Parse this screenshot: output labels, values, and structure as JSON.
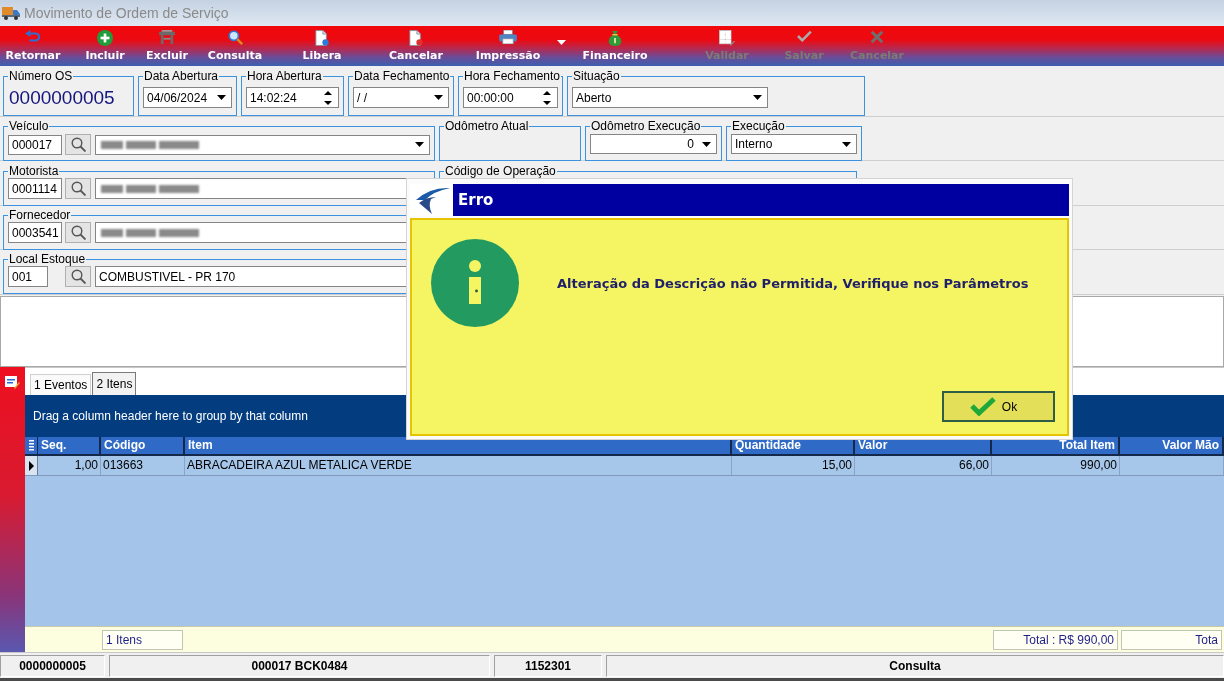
{
  "window": {
    "title": "Movimento de Ordem de Serviço"
  },
  "toolbar": [
    {
      "label": "Retornar",
      "disabled": false,
      "dropdown": false
    },
    {
      "label": "Incluir",
      "disabled": false,
      "dropdown": false
    },
    {
      "label": "Excluir",
      "disabled": false,
      "dropdown": false
    },
    {
      "label": "Consulta",
      "disabled": false,
      "dropdown": false
    },
    {
      "label": "Libera",
      "disabled": false,
      "dropdown": false
    },
    {
      "label": "Cancelar",
      "disabled": false,
      "dropdown": false
    },
    {
      "label": "Impressão",
      "disabled": false,
      "dropdown": true
    },
    {
      "label": "Financeiro",
      "disabled": false,
      "dropdown": false
    },
    {
      "label": "Validar",
      "disabled": true,
      "dropdown": false
    },
    {
      "label": "Salvar",
      "disabled": true,
      "dropdown": false
    },
    {
      "label": "Cancelar",
      "disabled": true,
      "dropdown": false
    }
  ],
  "form": {
    "rows": [
      {
        "groups": [
          {
            "label": "Número OS",
            "kind": "display",
            "value": "0000000005"
          },
          {
            "label": "Data Abertura",
            "kind": "date",
            "value": "04/06/2024"
          },
          {
            "label": "Hora Abertura",
            "kind": "time",
            "value": "14:02:24"
          },
          {
            "label": "Data Fechamento",
            "kind": "date",
            "value": "/ /"
          },
          {
            "label": "Hora Fechamento",
            "kind": "time",
            "value": "00:00:00"
          },
          {
            "label": "Situação",
            "kind": "select",
            "value": "Aberto"
          }
        ]
      },
      {
        "groups": [
          {
            "label": "Veículo",
            "kind": "lookup",
            "code": "000017",
            "redacted": true,
            "dropdown": true
          },
          {
            "label": "Odômetro Atual",
            "kind": "empty"
          },
          {
            "label": "Odômetro Execução",
            "kind": "number",
            "value": "0"
          },
          {
            "label": "Execução",
            "kind": "select",
            "value": "Interno"
          }
        ]
      },
      {
        "groups": [
          {
            "label": "Motorista",
            "kind": "lookup",
            "code": "0001114",
            "redacted": true
          },
          {
            "label": "Código de Operação",
            "kind": "empty"
          }
        ]
      },
      {
        "groups": [
          {
            "label": "Fornecedor",
            "kind": "lookup",
            "code": "0003541",
            "redacted": true
          }
        ]
      },
      {
        "groups": [
          {
            "label": "Local Estoque",
            "kind": "lookup",
            "code": "001",
            "value": "COMBUSTIVEL - PR 170"
          }
        ]
      }
    ]
  },
  "tabs": [
    {
      "label": "1 Eventos",
      "selected": false
    },
    {
      "label": "2 Itens",
      "selected": true
    }
  ],
  "grid": {
    "group_hint": "Drag a column header here to group by that column",
    "columns": [
      {
        "label": "Seq."
      },
      {
        "label": "Código",
        "footer": "1 Itens"
      },
      {
        "label": "Item"
      },
      {
        "label": "Quantidade"
      },
      {
        "label": "Valor"
      },
      {
        "label": "Total Item",
        "footer": "Total : R$ 990,00"
      },
      {
        "label": "Valor Mão",
        "footer": "Tota"
      }
    ],
    "rows": [
      {
        "selected": true,
        "cells": [
          "1,00",
          "013663",
          "ABRACADEIRA AZUL METALICA VERDE",
          "15,00",
          "66,00",
          "990,00"
        ]
      }
    ]
  },
  "status_bar": [
    "0000000005",
    "000017 BCK0484",
    "1152301",
    "Consulta"
  ],
  "dialog": {
    "title": "Erro",
    "message": "Alteração da Descrição não Permitida, Verifique nos Parâmetros",
    "button": "Ok"
  }
}
